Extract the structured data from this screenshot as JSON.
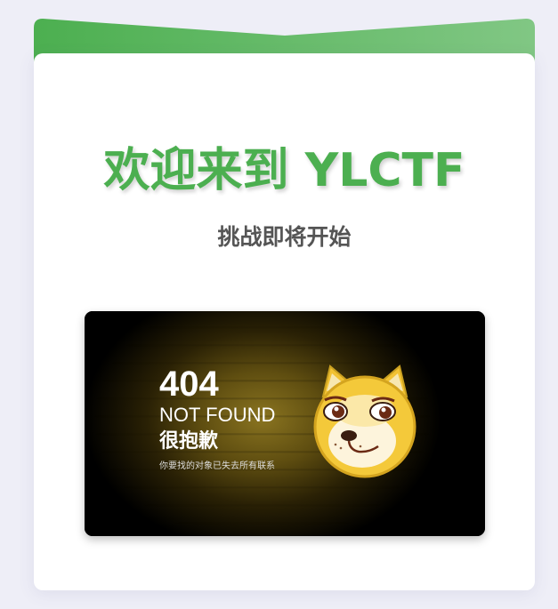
{
  "header": {
    "title": "欢迎来到 YLCTF",
    "subtitle": "挑战即将开始"
  },
  "error_image": {
    "code": "404",
    "not_found": "NOT FOUND",
    "sorry": "很抱歉",
    "description": "你要找的对象已失去所有联系"
  },
  "colors": {
    "accent": "#4caf50",
    "accent_light": "#81c784",
    "subtitle": "#555555",
    "background": "#eeeef7"
  },
  "icons": {
    "mascot": "doge-face-icon"
  }
}
